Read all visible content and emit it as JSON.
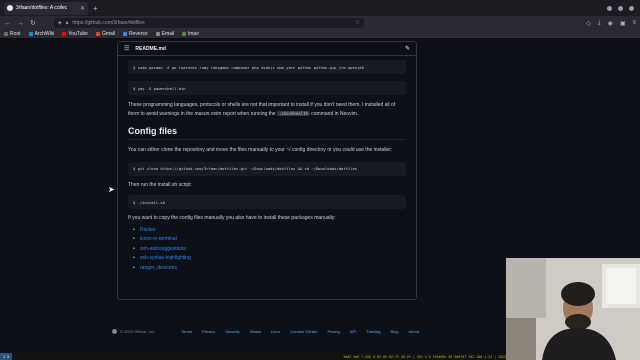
{
  "browser": {
    "tab_title": "3rfaan/dotfiles: A collec",
    "url": "https://github.com/3rfaan/dotfiles",
    "bookmarks": [
      {
        "label": "Root",
        "color": "#6e6e6e"
      },
      {
        "label": "ArchWiki",
        "color": "#1793d1"
      },
      {
        "label": "YouTube",
        "color": "#ff0000"
      },
      {
        "label": "Gmail",
        "color": "#ea4335"
      },
      {
        "label": "Reverso",
        "color": "#3b82f6"
      },
      {
        "label": "Email",
        "color": "#8c8c8c"
      },
      {
        "label": "lmao",
        "color": "#5a8e3a"
      }
    ]
  },
  "readme": {
    "filename": "README.md",
    "code1": "$ sudo pacman -S go luarocks ruby rubygems composer php nodejs npm yarn python python-pip jre-openjdk",
    "code2": "$ yay -S powershell-bin",
    "para1_a": "These programming languages, protocols or shells are not that important to install if you don't need them. I installed all of them to avoid warnings in the ",
    "para1_em": "mason.nvim",
    "para1_b": " report when running the ",
    "para1_code": ":checkhealth",
    "para1_c": " command in Neovim.",
    "heading": "Config files",
    "para2": "You can either clone the repository and move the files manually to your ~/.config directory or you could use the installer:",
    "code3": "$ git clone https://github.com/3rfaan/dotfiles.git ~/Downloads/dotfiles && cd ~/Downloads/dotfiles",
    "para3": "Then run the install.sh script:",
    "code4": "$ ./install.sh",
    "para4": "If you want to copy the config files manually you also have to install these packages manually:",
    "packages": [
      "Packer",
      "icons-in-terminal",
      "zsh-autosuggestions",
      "zsh-syntax-highlighting",
      "ranger_devicons"
    ]
  },
  "footer": {
    "copyright": "© 2023 GitHub, Inc.",
    "links": [
      "Terms",
      "Privacy",
      "Security",
      "Status",
      "Docs",
      "Contact GitHub",
      "Pricing",
      "API",
      "Training",
      "Blog",
      "About"
    ]
  },
  "statusbar": {
    "workspace": "1 3",
    "system": "3d8G 4m5 7.45G 0.0% 0% 62.7% 49.2% | 45% 2.0 FiDsRBz 83 900787 192.168.1.24 | 2023-"
  }
}
